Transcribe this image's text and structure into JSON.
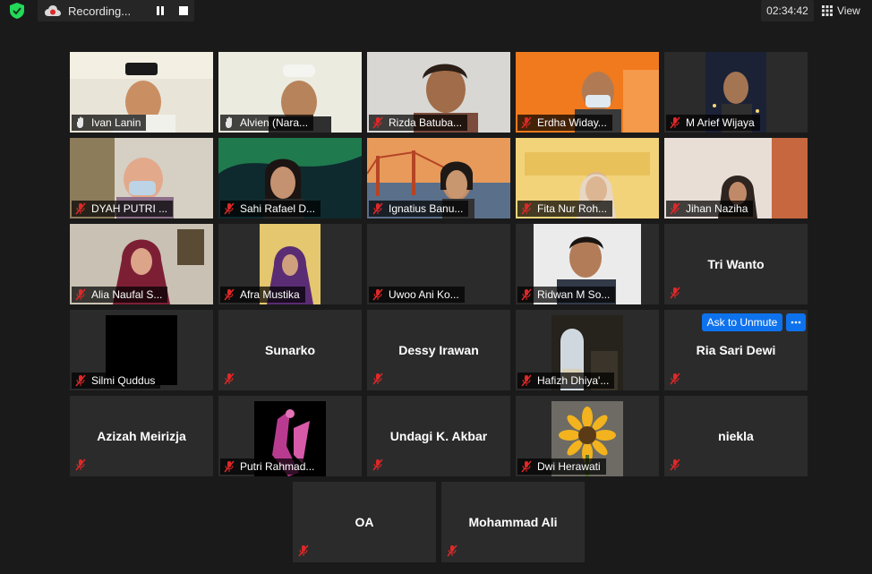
{
  "top_bar": {
    "recording_label": "Recording...",
    "elapsed_time": "02:34:42",
    "view_label": "View"
  },
  "participants": [
    {
      "name": "Ivan Lanin"
    },
    {
      "name": "Alvien (Nara..."
    },
    {
      "name": "Rizda Batuba..."
    },
    {
      "name": "Erdha Widay..."
    },
    {
      "name": "M Arief Wijaya"
    },
    {
      "name": "DYAH PUTRI ..."
    },
    {
      "name": "Sahi Rafael D..."
    },
    {
      "name": "Ignatius Banu..."
    },
    {
      "name": "Fita Nur Roh..."
    },
    {
      "name": "Jihan Naziha"
    },
    {
      "name": "Alia Naufal S..."
    },
    {
      "name": "Afra Mustika"
    },
    {
      "name": "Uwoo Ani Ko..."
    },
    {
      "name": "Ridwan M So..."
    },
    {
      "display_name": "Tri Wanto"
    },
    {
      "name": "Silmi Quddus"
    },
    {
      "display_name": "Sunarko"
    },
    {
      "display_name": "Dessy Irawan"
    },
    {
      "name": "Hafizh Dhiya'..."
    },
    {
      "display_name": "Ria Sari Dewi"
    },
    {
      "display_name": "Azizah Meirizja"
    },
    {
      "name": "Putri Rahmad..."
    },
    {
      "display_name": "Undagi K. Akbar"
    },
    {
      "name": "Dwi Herawati"
    },
    {
      "display_name": "niekla"
    },
    {
      "display_name": "OA"
    },
    {
      "display_name": "Mohammad Ali"
    }
  ],
  "hover_controls": {
    "ask_to_unmute_label": "Ask to Unmute"
  },
  "icons": {
    "security": "shield-check-icon",
    "recording": "cloud-record-icon",
    "pause": "pause-icon",
    "stop": "stop-icon",
    "view": "grid-view-icon",
    "muted": "mic-muted-icon",
    "more": "more-dots-icon"
  },
  "colors": {
    "background": "#1a1a1a",
    "tile": "#2b2b2b",
    "active_speaker": "#c8e26f",
    "accent_blue": "#0e72ed",
    "muted_red": "#e02828",
    "security_green": "#23d959"
  }
}
